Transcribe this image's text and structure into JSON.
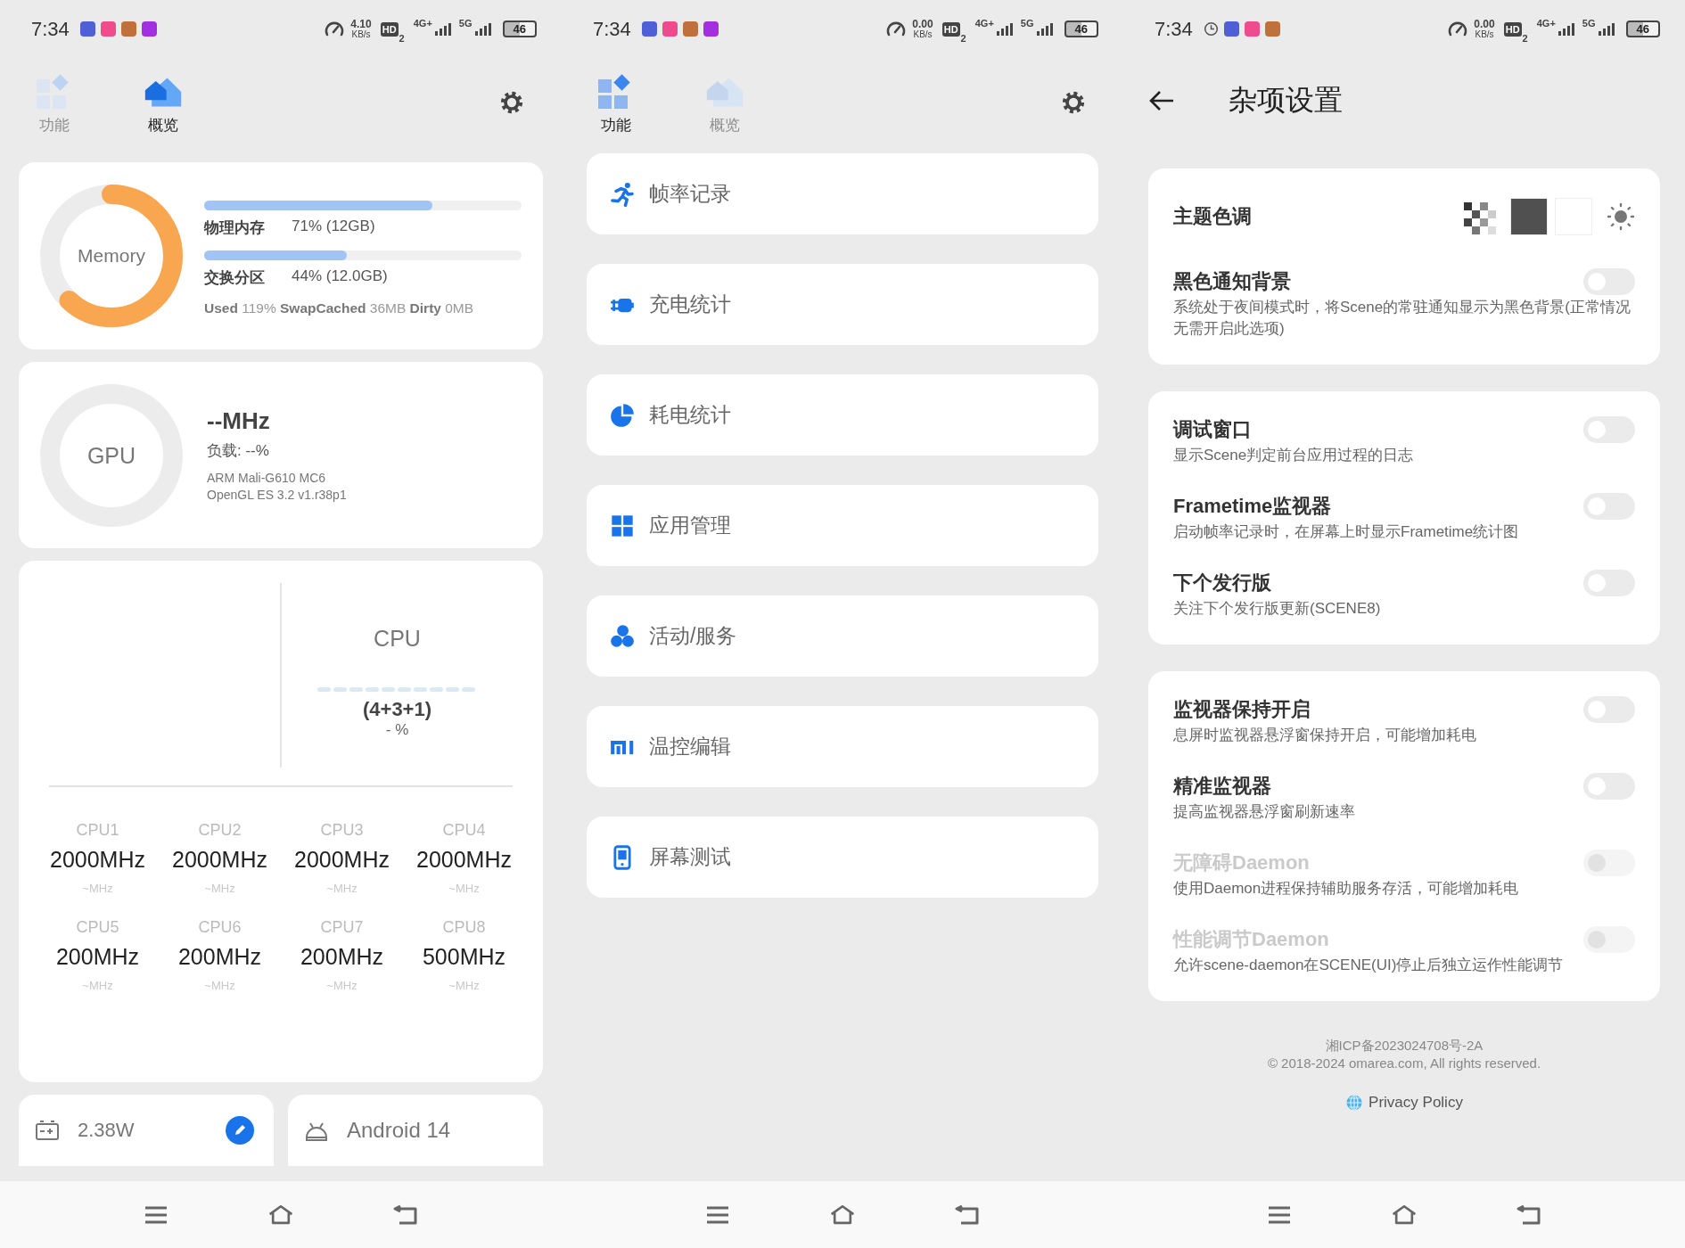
{
  "screens": [
    {
      "kind": "overview",
      "status_bar": {
        "time": "7:34",
        "notifications": [
          {
            "kind": "app",
            "color": "#4f5fd6"
          },
          {
            "kind": "app",
            "color": "#ee4c8c"
          },
          {
            "kind": "app",
            "color": "#c0703a"
          },
          {
            "kind": "app",
            "color": "#a22fe0"
          }
        ],
        "speed": "4.10",
        "speed_unit": "KB/s",
        "hd": "HD",
        "hd_slot": "2",
        "net_1": "4G+",
        "net_2": "5G",
        "battery": "46"
      },
      "tabs": [
        {
          "kind": "grid",
          "label": "功能",
          "selected": false
        },
        {
          "kind": "home",
          "label": "概览",
          "selected": true
        }
      ],
      "memory": {
        "label": "Memory",
        "level": 0.62,
        "bars": [
          {
            "label": "物理内存",
            "value": "71% (12GB)",
            "level": 0.72
          },
          {
            "label": "交换分区",
            "value": "44% (12.0GB)",
            "level": 0.45
          }
        ],
        "stats": "**Used** 119% **SwapCached** 36MB  **Dirty** 0MB"
      },
      "gpu": {
        "label": "GPU",
        "frequency": "--MHz",
        "load": "负载: --%",
        "model": "ARM Mali-G610 MC6",
        "driver": "OpenGL ES 3.2 v1.r38p1"
      },
      "cpu": {
        "label": "CPU",
        "clusters": "(4+3+1)",
        "load": "- %",
        "cores": [
          {
            "name": "CPU1",
            "frequency": "2000MHz",
            "range": "~MHz"
          },
          {
            "name": "CPU2",
            "frequency": "2000MHz",
            "range": "~MHz"
          },
          {
            "name": "CPU3",
            "frequency": "2000MHz",
            "range": "~MHz"
          },
          {
            "name": "CPU4",
            "frequency": "2000MHz",
            "range": "~MHz"
          },
          {
            "name": "CPU5",
            "frequency": "200MHz",
            "range": "~MHz"
          },
          {
            "name": "CPU6",
            "frequency": "200MHz",
            "range": "~MHz"
          },
          {
            "name": "CPU7",
            "frequency": "200MHz",
            "range": "~MHz"
          },
          {
            "name": "CPU8",
            "frequency": "500MHz",
            "range": "~MHz"
          }
        ]
      },
      "power": {
        "value": "2.38W"
      },
      "system": {
        "value": "Android 14"
      }
    },
    {
      "kind": "features",
      "status_bar": {
        "time": "7:34",
        "notifications": [
          {
            "kind": "app",
            "color": "#4f5fd6"
          },
          {
            "kind": "app",
            "color": "#ee4c8c"
          },
          {
            "kind": "app",
            "color": "#c0703a"
          },
          {
            "kind": "app",
            "color": "#a22fe0"
          }
        ],
        "speed": "0.00",
        "speed_unit": "KB/s",
        "hd": "HD",
        "hd_slot": "2",
        "net_1": "4G+",
        "net_2": "5G",
        "battery": "46"
      },
      "tabs": [
        {
          "kind": "grid",
          "label": "功能",
          "selected": true
        },
        {
          "kind": "home",
          "label": "概览",
          "selected": false
        }
      ],
      "menu": [
        {
          "kind": "run",
          "label": "帧率记录"
        },
        {
          "kind": "plug",
          "label": "充电统计"
        },
        {
          "kind": "pie",
          "label": "耗电统计"
        },
        {
          "kind": "apps",
          "label": "应用管理"
        },
        {
          "kind": "services",
          "label": "活动/服务"
        },
        {
          "kind": "bars",
          "label": "温控编辑"
        },
        {
          "kind": "phone",
          "label": "屏幕测试"
        }
      ]
    },
    {
      "kind": "settings",
      "status_bar": {
        "time": "7:34",
        "notifications": [
          {
            "kind": "clock"
          },
          {
            "kind": "app",
            "color": "#4f5fd6"
          },
          {
            "kind": "app",
            "color": "#ee4c8c"
          },
          {
            "kind": "app",
            "color": "#c0703a"
          }
        ],
        "speed": "0.00",
        "speed_unit": "KB/s",
        "hd": "HD",
        "hd_slot": "2",
        "net_1": "4G+",
        "net_2": "5G",
        "battery": "46"
      },
      "title": "杂项设置",
      "groups": [
        {
          "items": [
            {
              "kind": "theme",
              "title": "主题色调",
              "swatches": [
                {
                  "kind": "checker"
                },
                {
                  "kind": "solid",
                  "color": "#505050"
                },
                {
                  "kind": "solid",
                  "color": "#ffffff"
                }
              ]
            },
            {
              "kind": "toggle",
              "title": "黑色通知背景",
              "desc": "系统处于夜间模式时，将Scene的常驻通知显示为黑色背景(正常情况无需开启此选项)",
              "on": false,
              "disabled": false
            }
          ]
        },
        {
          "items": [
            {
              "kind": "toggle",
              "title": "调试窗口",
              "desc": "显示Scene判定前台应用过程的日志",
              "on": false,
              "disabled": false
            },
            {
              "kind": "toggle",
              "title": "Frametime监视器",
              "desc": "启动帧率记录时，在屏幕上时显示Frametime统计图",
              "on": false,
              "disabled": false
            },
            {
              "kind": "toggle",
              "title": "下个发行版",
              "desc": "关注下个发行版更新(SCENE8)",
              "on": false,
              "disabled": false
            }
          ]
        },
        {
          "items": [
            {
              "kind": "toggle",
              "title": "监视器保持开启",
              "desc": "息屏时监视器悬浮窗保持开启，可能增加耗电",
              "on": false,
              "disabled": false
            },
            {
              "kind": "toggle",
              "title": "精准监视器",
              "desc": "提高监视器悬浮窗刷新速率",
              "on": false,
              "disabled": false
            },
            {
              "kind": "toggle",
              "title": "无障碍Daemon",
              "desc": "使用Daemon进程保持辅助服务存活，可能增加耗电",
              "on": false,
              "disabled": true
            },
            {
              "kind": "toggle",
              "title": "性能调节Daemon",
              "desc": "允许scene-daemon在SCENE(UI)停止后独立运作性能调节",
              "on": false,
              "disabled": true
            }
          ]
        }
      ],
      "footer": {
        "license": "湘ICP备2023024708号-2A",
        "copyright": "© 2018-2024 omarea.com, All rights reserved.",
        "privacy": "Privacy Policy"
      }
    }
  ]
}
